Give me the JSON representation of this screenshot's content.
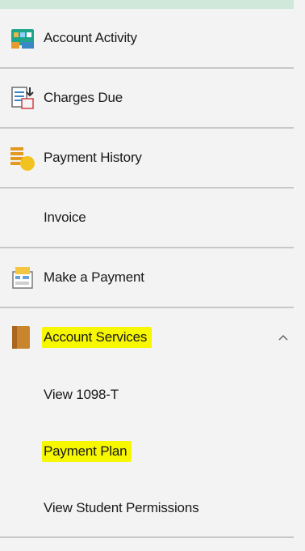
{
  "menu": {
    "items": [
      {
        "label": "Account Activity",
        "icon": "account-activity-icon"
      },
      {
        "label": "Charges Due",
        "icon": "charges-due-icon"
      },
      {
        "label": "Payment History",
        "icon": "payment-history-icon"
      },
      {
        "label": "Invoice",
        "icon": ""
      },
      {
        "label": "Make a Payment",
        "icon": "make-payment-icon"
      },
      {
        "label": "Account Services",
        "icon": "account-services-icon",
        "expanded": true
      }
    ],
    "submenu": [
      {
        "label": "View 1098-T"
      },
      {
        "label": "Payment Plan"
      },
      {
        "label": "View Student Permissions"
      }
    ]
  },
  "colors": {
    "highlight": "#f7f700",
    "divider": "#c8c8c8",
    "background": "#f3f3f3",
    "top_accent": "#cfe8da"
  }
}
